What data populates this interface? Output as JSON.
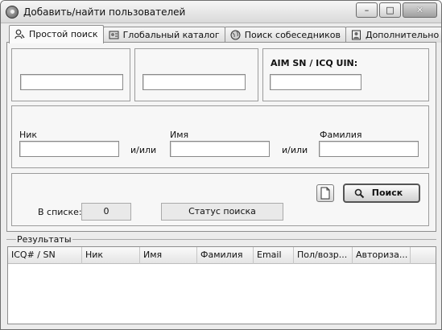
{
  "window": {
    "title": "Добавить/найти пользователей",
    "controls": {
      "minimize": "–",
      "maximize": "□",
      "close": "✕"
    }
  },
  "tabs": [
    {
      "label": "Простой поиск",
      "icon": "person-search-icon",
      "active": true
    },
    {
      "label": "Глобальный каталог",
      "icon": "catalog-icon",
      "active": false
    },
    {
      "label": "Поиск собеседников",
      "icon": "globe-icon",
      "active": false
    },
    {
      "label": "Дополнительно",
      "icon": "person-card-icon",
      "active": false
    }
  ],
  "uin_group": {
    "label": "AIM SN / ICQ UIN:",
    "value": ""
  },
  "email_group": {
    "value": ""
  },
  "phone_group": {
    "value": ""
  },
  "name_group": {
    "nick_label": "Ник",
    "first_label": "Имя",
    "last_label": "Фамилия",
    "andor_1": "и/или",
    "andor_2": "и/или",
    "nick_value": "",
    "first_value": "",
    "last_value": ""
  },
  "search": {
    "button_label": "Поиск",
    "in_list_label": "В списке:",
    "in_list_count": "0",
    "status_text": "Статус поиска"
  },
  "results": {
    "legend": "Результаты",
    "columns": [
      "ICQ# / SN",
      "Ник",
      "Имя",
      "Фамилия",
      "Email",
      "Пол/возр...",
      "Авториза..."
    ]
  }
}
